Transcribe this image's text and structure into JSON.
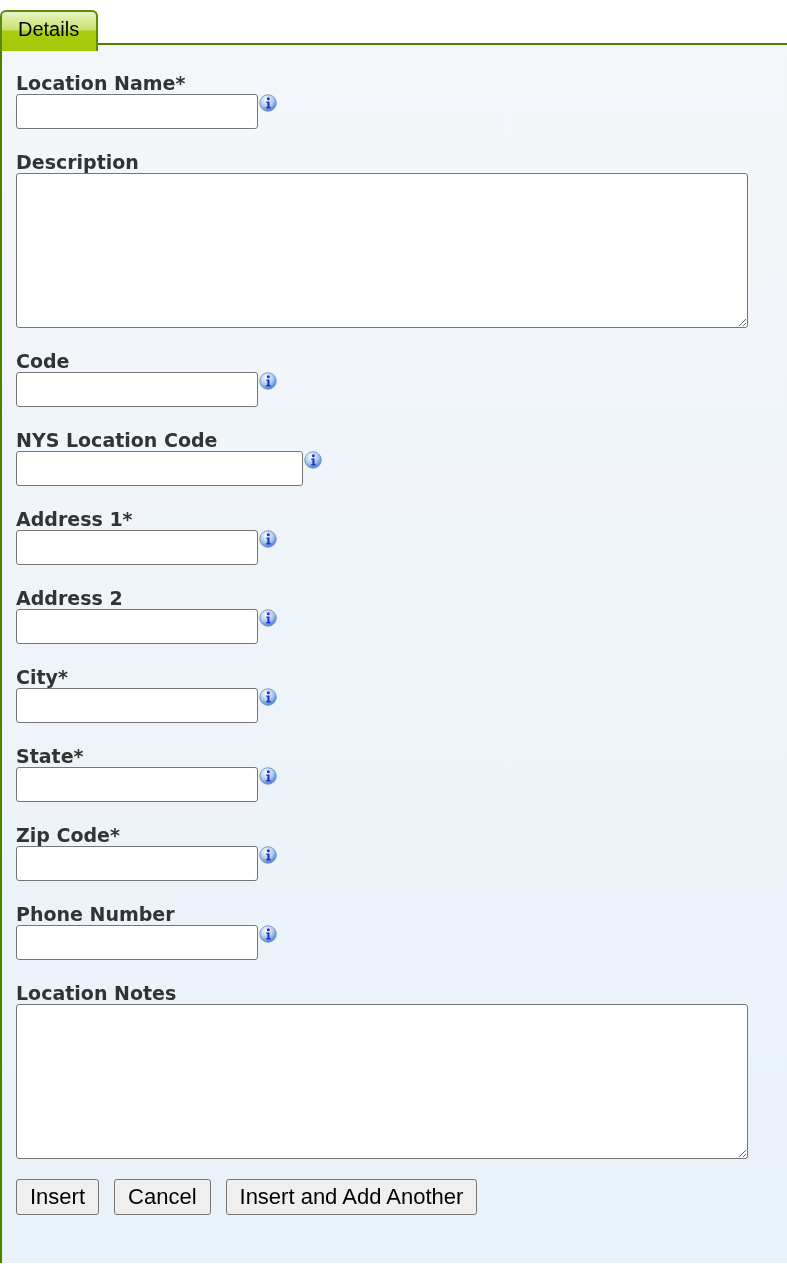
{
  "tabs": [
    {
      "label": "Details",
      "selected": true
    }
  ],
  "fields": [
    {
      "label": "Location Name*",
      "kind": "text"
    },
    {
      "label": "Description",
      "kind": "textarea"
    },
    {
      "label": "Code",
      "kind": "text"
    },
    {
      "label": "NYS Location Code",
      "kind": "wide"
    },
    {
      "label": "Address 1*",
      "kind": "text"
    },
    {
      "label": "Address 2",
      "kind": "text"
    },
    {
      "label": "City*",
      "kind": "text"
    },
    {
      "label": "State*",
      "kind": "text"
    },
    {
      "label": "Zip Code*",
      "kind": "text"
    },
    {
      "label": "Phone Number",
      "kind": "text"
    },
    {
      "label": "Location Notes",
      "kind": "textarea"
    }
  ],
  "buttons": [
    "Insert",
    "Cancel",
    "Insert and Add Another"
  ]
}
